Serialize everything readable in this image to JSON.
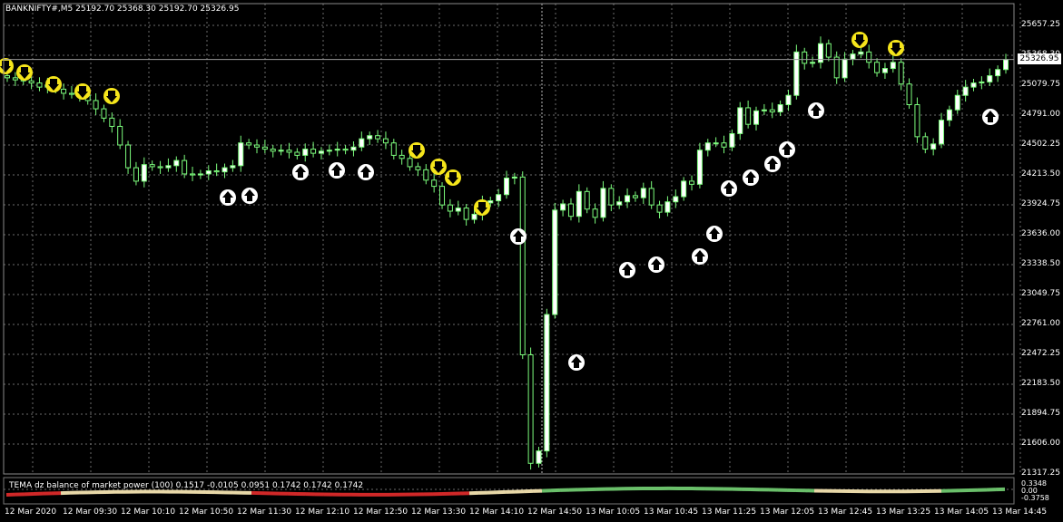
{
  "header": {
    "symbol_info": "BANKNIFTY#,M5  25192.70 25368.30 25192.70 25326.95"
  },
  "indicator": {
    "title": "TEMA dz balance of market power (100) 0.1517 -0.0105 0.0951 0.1742 0.1742 0.1742",
    "levels": [
      "0.3348",
      "0.00",
      "-0.3758"
    ]
  },
  "price_axis": {
    "labels": [
      "25657.25",
      "25368.30",
      "25079.75",
      "24791.00",
      "24502.25",
      "24213.50",
      "23924.75",
      "23636.00",
      "23338.50",
      "23049.75",
      "22761.00",
      "22472.25",
      "22183.50",
      "21894.75",
      "21606.00",
      "21317.25"
    ],
    "current_price": "25326.95"
  },
  "time_axis": {
    "labels": [
      "12 Mar 2020",
      "12 Mar 09:30",
      "12 Mar 10:10",
      "12 Mar 10:50",
      "12 Mar 11:30",
      "12 Mar 12:10",
      "12 Mar 12:50",
      "12 Mar 13:30",
      "12 Mar 14:10",
      "12 Mar 14:50",
      "13 Mar 10:05",
      "13 Mar 10:45",
      "13 Mar 11:25",
      "13 Mar 12:05",
      "13 Mar 12:45",
      "13 Mar 13:25",
      "13 Mar 14:05",
      "13 Mar 14:45"
    ]
  },
  "colors": {
    "background": "#000000",
    "grid": "#6b6b6b",
    "bull_candle": "#ffffff",
    "bear_candle": "#000000",
    "wick": "#7cfc7c",
    "sell_signal": "#f5e51b",
    "buy_signal": "#ffffff",
    "indicator_pos": "#6abf6a",
    "indicator_neg": "#d02828",
    "indicator_neutral": "#e8d8a8"
  },
  "chart_data": {
    "type": "candlestick",
    "symbol": "BANKNIFTY#",
    "timeframe": "M5",
    "ylim": [
      21317.25,
      25657.25
    ],
    "ohlc_last": {
      "open": 25192.7,
      "high": 25368.3,
      "low": 25192.7,
      "close": 25326.95
    },
    "close_series": [
      25150,
      25130,
      25120,
      25100,
      25060,
      25080,
      25040,
      25000,
      24990,
      24980,
      24930,
      24850,
      24760,
      24680,
      24500,
      24280,
      24150,
      24310,
      24290,
      24280,
      24300,
      24350,
      24220,
      24210,
      24220,
      24250,
      24240,
      24280,
      24300,
      24520,
      24500,
      24480,
      24460,
      24440,
      24450,
      24430,
      24400,
      24460,
      24420,
      24440,
      24450,
      24460,
      24450,
      24480,
      24560,
      24590,
      24560,
      24520,
      24400,
      24370,
      24290,
      24260,
      24160,
      24100,
      23920,
      23860,
      23890,
      23780,
      23830,
      23940,
      23960,
      24020,
      24180,
      24190,
      22470,
      21420,
      21540,
      22860,
      23870,
      23930,
      23810,
      24050,
      23880,
      23800,
      24080,
      23920,
      23950,
      24010,
      23990,
      24080,
      23920,
      23850,
      23950,
      24000,
      24150,
      24120,
      24450,
      24520,
      24520,
      24480,
      24610,
      24860,
      24700,
      24830,
      24840,
      24820,
      24890,
      24980,
      25400,
      25290,
      25300,
      25480,
      25350,
      25150,
      25330,
      25380,
      25400,
      25300,
      25200,
      25240,
      25300,
      25090,
      24890,
      24580,
      24460,
      24510,
      24740,
      24840,
      24980,
      25060,
      25100,
      25110,
      25170,
      25230,
      25327
    ],
    "signals": {
      "sell_count": 12,
      "buy_count": 22
    }
  }
}
